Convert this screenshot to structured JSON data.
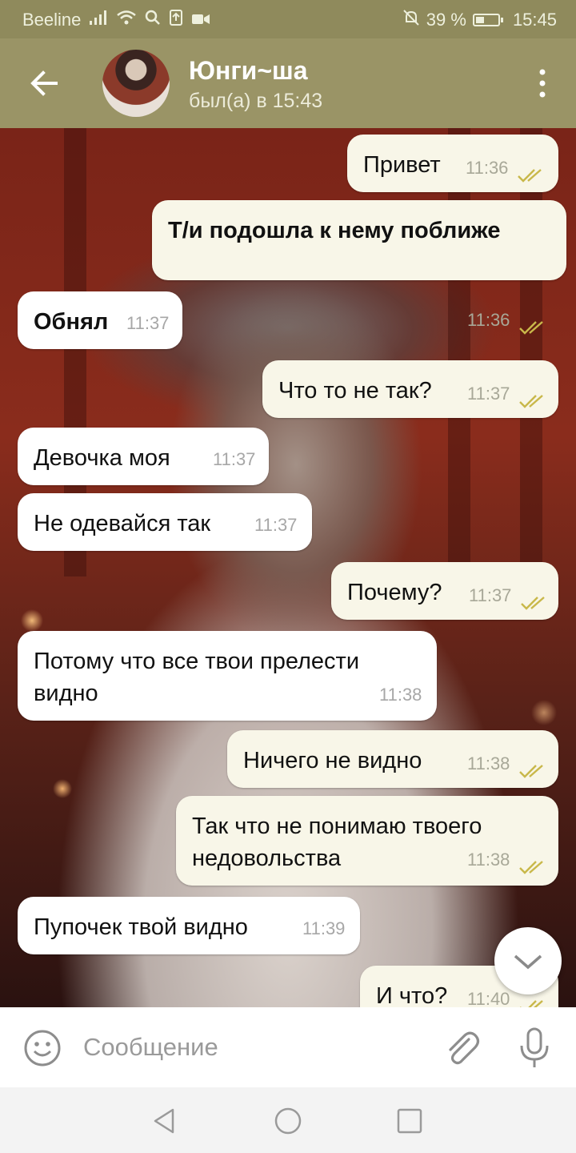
{
  "status_bar": {
    "carrier": "Beeline",
    "battery_percent": "39 %",
    "battery_level": 0.39,
    "time": "15:45",
    "icons": [
      "signal-icon",
      "wifi-icon",
      "search-icon",
      "upload-icon",
      "video-icon",
      "mute-icon",
      "battery-icon"
    ]
  },
  "header": {
    "back_icon": "arrow-left-icon",
    "name": "Юнги~ша",
    "status": "был(а) в 15:43",
    "menu_icon": "more-vertical-icon"
  },
  "messages": [
    {
      "direction": "out",
      "text": "Привет",
      "time": "11:36",
      "read": true,
      "bold": false
    },
    {
      "direction": "out",
      "text": "Т/и подошла к нему поближе",
      "time": "11:36",
      "read": true,
      "bold": true
    },
    {
      "direction": "in",
      "text": "Обнял",
      "time": "11:37",
      "bold": true
    },
    {
      "direction": "out",
      "text": "Что то не так?",
      "time": "11:37",
      "read": true,
      "bold": false
    },
    {
      "direction": "in",
      "text": "Девочка моя",
      "time": "11:37",
      "bold": false
    },
    {
      "direction": "in",
      "text": "Не одевайся так",
      "time": "11:37",
      "bold": false
    },
    {
      "direction": "out",
      "text": "Почему?",
      "time": "11:37",
      "read": true,
      "bold": false
    },
    {
      "direction": "in",
      "text": "Потому что все твои прелести видно",
      "time": "11:38",
      "bold": false
    },
    {
      "direction": "out",
      "text": "Ничего не видно",
      "time": "11:38",
      "read": true,
      "bold": false
    },
    {
      "direction": "out",
      "text": "Так что не понимаю твоего недовольства",
      "time": "11:38",
      "read": true,
      "bold": false
    },
    {
      "direction": "in",
      "text": "Пупочек твой видно",
      "time": "11:39",
      "bold": false
    },
    {
      "direction": "out",
      "text": "И что?",
      "time": "11:40",
      "read": true,
      "bold": false
    }
  ],
  "composer": {
    "placeholder": "Сообщение",
    "value": "",
    "emoji_icon": "emoji-icon",
    "attach_icon": "paperclip-icon",
    "mic_icon": "microphone-icon"
  },
  "scroll_button_icon": "chevron-down-icon",
  "nav": {
    "icons": [
      "back-triangle-icon",
      "home-circle-icon",
      "recents-square-icon"
    ]
  },
  "colors": {
    "header_bg": "#9a9466",
    "status_bg": "#8f8a5c",
    "outgoing_bubble": "#f8f6e8",
    "incoming_bubble": "#ffffff",
    "read_ticks": "#c9b84a"
  }
}
